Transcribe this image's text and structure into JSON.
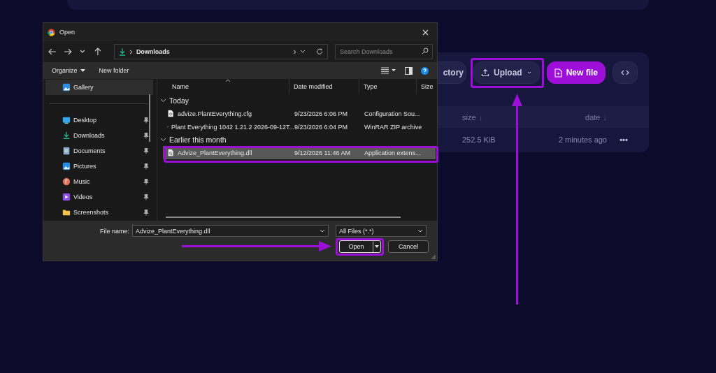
{
  "page": {
    "toolbar": [
      {
        "kind": "plain",
        "label": "ctory"
      },
      {
        "kind": "dropdown",
        "label": "Upload"
      },
      {
        "kind": "primary",
        "label": "New file"
      },
      {
        "kind": "code"
      }
    ],
    "table": {
      "columns": [
        {
          "label": "size",
          "sort": "↓"
        },
        {
          "label": "date",
          "sort": "↓"
        }
      ],
      "rows": [
        {
          "size": "252.5 KiB",
          "date": "2 minutes ago",
          "menu": "•••"
        }
      ]
    }
  },
  "dialog": {
    "title": "Open",
    "address": "Downloads",
    "search": {
      "placeholder": "Search Downloads"
    },
    "commands": [
      "Organize",
      "New folder"
    ],
    "nav": [
      {
        "kind": "gallery",
        "label": "Gallery",
        "selected": true,
        "pinned": false
      },
      {
        "kind": "desktop",
        "label": "Desktop",
        "selected": false,
        "pinned": true
      },
      {
        "kind": "downloads",
        "label": "Downloads",
        "selected": false,
        "pinned": true
      },
      {
        "kind": "documents",
        "label": "Documents",
        "selected": false,
        "pinned": true
      },
      {
        "kind": "pictures",
        "label": "Pictures",
        "selected": false,
        "pinned": true
      },
      {
        "kind": "music",
        "label": "Music",
        "selected": false,
        "pinned": true
      },
      {
        "kind": "videos",
        "label": "Videos",
        "selected": false,
        "pinned": true
      },
      {
        "kind": "folder",
        "label": "Screenshots",
        "selected": false,
        "pinned": true
      }
    ],
    "columns": [
      "Name",
      "Date modified",
      "Type",
      "Size"
    ],
    "groups": [
      {
        "label": "Today",
        "expanded": true,
        "files": [
          {
            "kind": "config",
            "name": "advize.PlantEverything.cfg",
            "date": "9/23/2026 6:06 PM",
            "type": "Configuration Sou...",
            "selected": false
          },
          {
            "kind": "archive",
            "name": "Plant Everything 1042 1.21.2 2026-09-12T...",
            "date": "9/23/2026 6:04 PM",
            "type": "WinRAR ZIP archive",
            "selected": false
          }
        ]
      },
      {
        "label": "Earlier this month",
        "expanded": true,
        "files": [
          {
            "kind": "dll",
            "name": "Advize_PlantEverything.dll",
            "date": "9/12/2026 11:46 AM",
            "type": "Application extens...",
            "selected": true
          }
        ]
      }
    ],
    "file_name_label": "File name:",
    "file_name": "Advize_PlantEverything.dll",
    "filter": "All Files (*.*)",
    "buttons": [
      {
        "kind": "split",
        "label": "Open"
      },
      {
        "kind": "plain",
        "label": "Cancel"
      }
    ]
  }
}
